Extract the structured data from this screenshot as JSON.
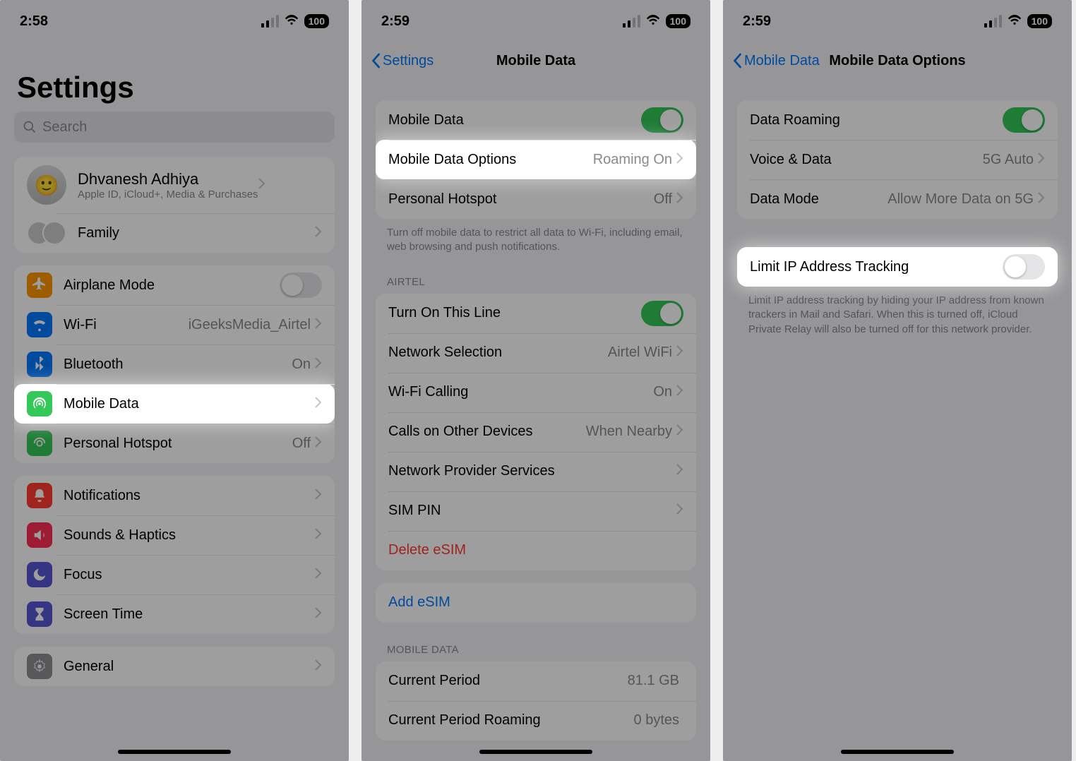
{
  "status": {
    "time1": "2:58",
    "time2": "2:59",
    "time3": "2:59",
    "battery": "100"
  },
  "screen1": {
    "title": "Settings",
    "search_placeholder": "Search",
    "user": {
      "name": "Dhvanesh Adhiya",
      "sub": "Apple ID, iCloud+, Media & Purchases"
    },
    "family": "Family",
    "rows": {
      "airplane": "Airplane Mode",
      "wifi": "Wi-Fi",
      "wifi_val": "iGeeksMedia_Airtel",
      "bluetooth": "Bluetooth",
      "bluetooth_val": "On",
      "mobile": "Mobile Data",
      "hotspot": "Personal Hotspot",
      "hotspot_val": "Off",
      "notifications": "Notifications",
      "sounds": "Sounds & Haptics",
      "focus": "Focus",
      "screen_time": "Screen Time",
      "general": "General"
    }
  },
  "screen2": {
    "back": "Settings",
    "title": "Mobile Data",
    "group1": {
      "mobile_data": "Mobile Data",
      "options": "Mobile Data Options",
      "options_val": "Roaming On",
      "hotspot": "Personal Hotspot",
      "hotspot_val": "Off"
    },
    "footer1": "Turn off mobile data to restrict all data to Wi-Fi, including email, web browsing and push notifications.",
    "header_airtel": "AIRTEL",
    "group2": {
      "turn_on": "Turn On This Line",
      "network_sel": "Network Selection",
      "network_sel_val": "Airtel WiFi",
      "wifi_calling": "Wi-Fi Calling",
      "wifi_calling_val": "On",
      "calls_other": "Calls on Other Devices",
      "calls_other_val": "When Nearby",
      "provider": "Network Provider Services",
      "sim_pin": "SIM PIN",
      "delete_esim": "Delete eSIM"
    },
    "add_esim": "Add eSIM",
    "header_md": "MOBILE DATA",
    "group3": {
      "current": "Current Period",
      "current_val": "81.1 GB",
      "current_roam": "Current Period Roaming",
      "current_roam_val": "0 bytes"
    }
  },
  "screen3": {
    "back": "Mobile Data",
    "title": "Mobile Data Options",
    "group1": {
      "roaming": "Data Roaming",
      "voice": "Voice & Data",
      "voice_val": "5G Auto",
      "mode": "Data Mode",
      "mode_val": "Allow More Data on 5G"
    },
    "group2": {
      "limit_ip": "Limit IP Address Tracking"
    },
    "footer": "Limit IP address tracking by hiding your IP address from known trackers in Mail and Safari. When this is turned off, iCloud Private Relay will also be turned off for this network provider."
  }
}
